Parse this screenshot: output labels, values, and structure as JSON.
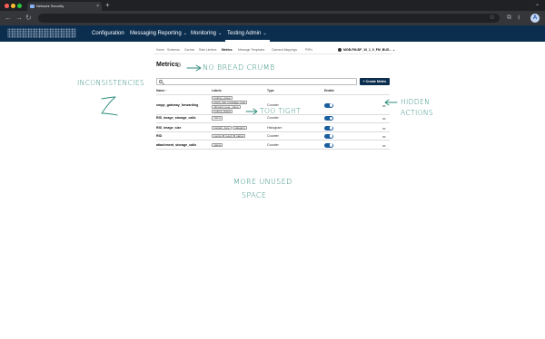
{
  "browser": {
    "tab_title": "Network Security",
    "tab_close": "×",
    "new_tab": "+",
    "profile_initial": "A",
    "icons": [
      "back-icon",
      "forward-icon",
      "reload-icon",
      "star-icon",
      "extensions-icon",
      "split-view-icon",
      "download-icon",
      "profile-icon"
    ]
  },
  "app": {
    "nav": [
      {
        "label": "Configuration",
        "has_menu": false
      },
      {
        "label": "Messaging Reporting",
        "has_menu": true
      },
      {
        "label": "Monitoring",
        "has_menu": true
      },
      {
        "label": "Testing Admin",
        "has_menu": true
      }
    ],
    "active_nav": "Testing Admin",
    "subnav": [
      "Home",
      "Schemas",
      "Caches",
      "Rate Limiters",
      "Metrics",
      "Message Templates",
      "Operand Mappings",
      "PIIPs"
    ],
    "active_subnav": "Metrics",
    "tenant": "MOB-FM-BF_10_1_0_FM_BUS...",
    "colors": {
      "header": "#0b2e4f",
      "toggle": "#1b5e9e",
      "annotation": "#2b8a7a"
    }
  },
  "metrics": {
    "title": "Metrics",
    "search_placeholder": "",
    "create_button": "+ Create Metric",
    "columns": [
      "Name ↑",
      "Labels",
      "Type",
      "Enable"
    ],
    "rows": [
      {
        "name": "smpp_gateway_forwarding",
        "labels": [
          "routing_group",
          "smpp_ack_message_type",
          "inbound_peer_name",
          "routing_status"
        ],
        "type": "Counter",
        "enabled": true
      },
      {
        "name": "RID_image_storage_calls",
        "labels": [
          "status"
        ],
        "type": "Counter",
        "enabled": true
      },
      {
        "name": "RID_image_size",
        "labels": [
          "content_type",
          "category"
        ],
        "type": "Histogram",
        "enabled": true
      },
      {
        "name": "RID",
        "labels": [
          "source",
          "result",
          "status"
        ],
        "type": "Counter",
        "enabled": true
      },
      {
        "name": "attachment_storage_calls",
        "labels": [
          "status"
        ],
        "type": "Counter",
        "enabled": true
      }
    ],
    "row_actions": "•••"
  },
  "annotations": {
    "no_breadcrumb": "NO BREAD CRUMB",
    "inconsistencies": "INCONSISTENCIES",
    "z_mark": "Z",
    "too_tight": "TOO TIGHT",
    "hidden_actions_1": "HIDDEN",
    "hidden_actions_2": "ACTIONS",
    "unused_space_1": "MORE UNUSED",
    "unused_space_2": "SPACE"
  }
}
